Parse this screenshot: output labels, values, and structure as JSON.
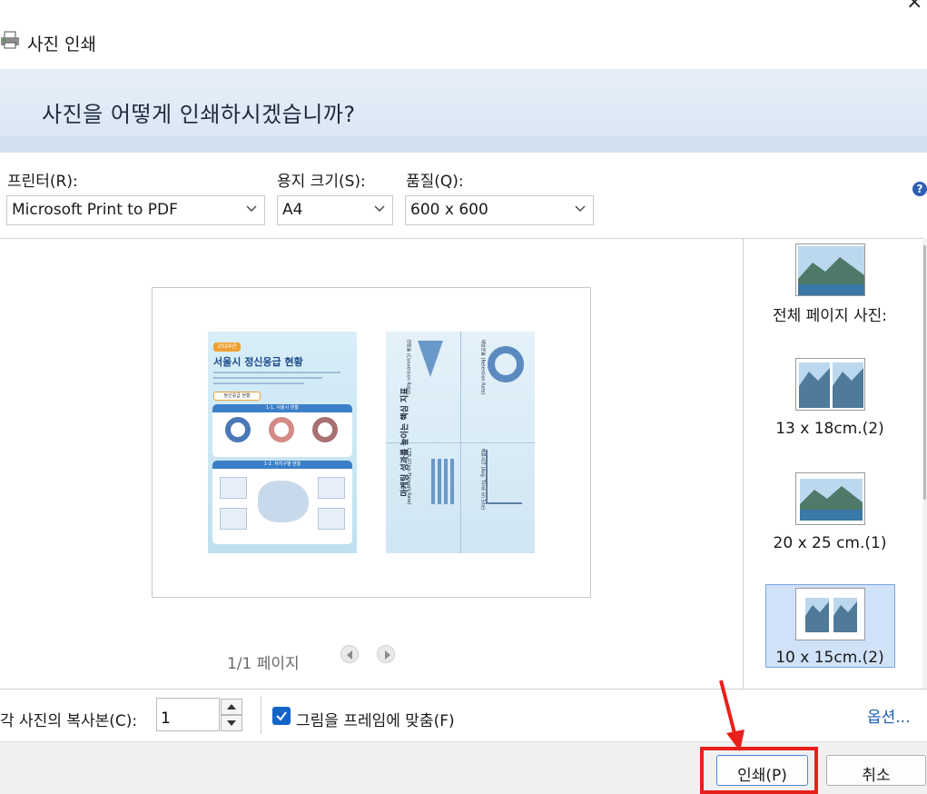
{
  "window": {
    "title": "사진 인쇄",
    "close_glyph": "×"
  },
  "header": {
    "question": "사진을 어떻게 인쇄하시겠습니까?"
  },
  "options": {
    "printer_label": "프린터(R):",
    "printer_value": "Microsoft Print to PDF",
    "paper_size_label": "용지 크기(S):",
    "paper_size_value": "A4",
    "quality_label": "품질(Q):",
    "quality_value": "600 x 600",
    "help_glyph": "?"
  },
  "preview": {
    "page_counter": "1/1 페이지",
    "left_photo": {
      "year_badge": "2024년",
      "title": "서울시 정신응급 현황",
      "subtitle": "정신응급 현황",
      "section_1": "1-1. 서울시 현황",
      "section_2": "1-2. 자치구별 현황"
    },
    "right_photo": {
      "vertical_title": "마케팅 성과를 높이는 핵심 지표",
      "kpi_1": "전환율 (Conversion Rate)",
      "kpi_2": "재방문율 (Retention Rate)",
      "kpi_3": "CTR (Click-Through Rate)",
      "kpi_4": "체류시간 (Avg. Time on Site)"
    }
  },
  "layouts": {
    "items": [
      {
        "label": "전체 페이지 사진:"
      },
      {
        "label": "13 x 18cm.(2)"
      },
      {
        "label": "20 x 25 cm.(1)"
      },
      {
        "label": "10 x 15cm.(2)"
      }
    ],
    "selected_index": 3
  },
  "bottom": {
    "copies_label": "각 사진의 복사본(C):",
    "copies_value": "1",
    "fit_label": "그림을 프레임에 맞춤(F)",
    "fit_checked": true,
    "options_link": "옵션..."
  },
  "footer": {
    "print_button": "인쇄(P)",
    "cancel_button": "취소"
  },
  "colors": {
    "accent": "#1464c8",
    "annotation": "#e8201c"
  }
}
